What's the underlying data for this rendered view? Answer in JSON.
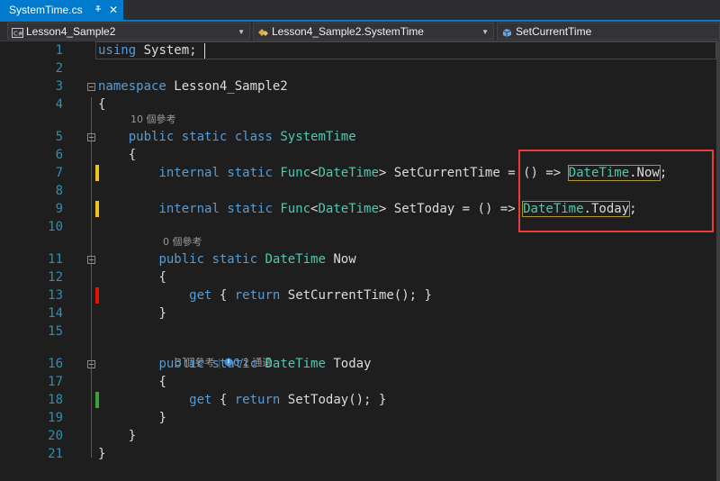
{
  "tab": {
    "title": "SystemTime.cs",
    "pin_icon": "pin-icon",
    "close_label": "✕"
  },
  "navbar": {
    "project": "Lesson4_Sample2",
    "class_path": "Lesson4_Sample2.SystemTime",
    "member": "SetCurrentTime"
  },
  "editor": {
    "lines": [
      {
        "n": "1",
        "code": "using System;"
      },
      {
        "n": "2",
        "code": ""
      },
      {
        "n": "3",
        "code": "namespace Lesson4_Sample2"
      },
      {
        "n": "4",
        "code": "{"
      },
      {
        "n": "5",
        "code": "public static class SystemTime"
      },
      {
        "n": "6",
        "code": "{"
      },
      {
        "n": "7",
        "code": "internal static Func<DateTime> SetCurrentTime = () => DateTime.Now;"
      },
      {
        "n": "8",
        "code": ""
      },
      {
        "n": "9",
        "code": "internal static Func<DateTime> SetToday = () => DateTime.Today;"
      },
      {
        "n": "10",
        "code": ""
      },
      {
        "n": "11",
        "code": "public static DateTime Now"
      },
      {
        "n": "12",
        "code": "{"
      },
      {
        "n": "13",
        "code": "get { return SetCurrentTime(); }"
      },
      {
        "n": "14",
        "code": "}"
      },
      {
        "n": "15",
        "code": ""
      },
      {
        "n": "16",
        "code": "public static DateTime Today"
      },
      {
        "n": "17",
        "code": "{"
      },
      {
        "n": "18",
        "code": "get { return SetToday(); }"
      },
      {
        "n": "19",
        "code": "}"
      },
      {
        "n": "20",
        "code": "}"
      },
      {
        "n": "21",
        "code": "}"
      }
    ],
    "codelens": {
      "class_refs": "10 個參考",
      "now_refs": "0 個參考",
      "today_refs": "3 個參考",
      "today_tests": "0/2 通過"
    },
    "tokens": {
      "using": "using",
      "system_ns": "System;",
      "namespace_kw": "namespace",
      "namespace_name": "Lesson4_Sample2",
      "public": "public",
      "static": "static",
      "class": "class",
      "internal": "internal",
      "func": "Func",
      "datetime": "DateTime",
      "class_name": "SystemTime",
      "set_current_time": "SetCurrentTime",
      "set_today": "SetToday",
      "lambda": "= () =>",
      "datetime_now": "DateTime",
      "dot_now": ".Now",
      "datetime_today": "DateTime",
      "dot_today": ".Today",
      "now_prop": "Now",
      "today_prop": "Today",
      "get": "get",
      "return": "return",
      "call_current": "SetCurrentTime();",
      "call_today": "SetToday();"
    },
    "colors": {
      "keyword": "#569cd6",
      "type": "#4ec9b0",
      "text": "#dcdcdc",
      "line_number": "#2b91af",
      "annotation_box": "#e83d3d",
      "marker_changed": "#f0c21f",
      "marker_failed": "#e51400",
      "marker_passed": "#3aa23a"
    }
  }
}
